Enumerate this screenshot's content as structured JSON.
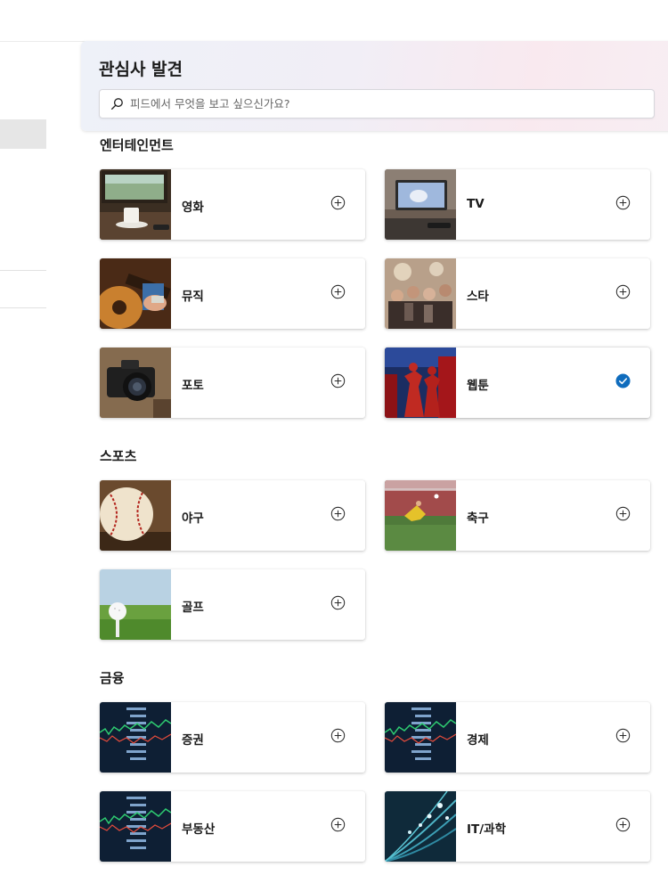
{
  "discover": {
    "title": "관심사 발견",
    "search_placeholder": "피드에서 무엇을 보고 싶으신가요?"
  },
  "sections": [
    {
      "title": "엔터테인먼트",
      "cards": [
        {
          "label": "영화",
          "thumb": "movie-thumb",
          "selected": false
        },
        {
          "label": "TV",
          "thumb": "tv-thumb",
          "selected": false
        },
        {
          "label": "뮤직",
          "thumb": "guitar-thumb",
          "selected": false
        },
        {
          "label": "스타",
          "thumb": "crowd-thumb",
          "selected": false
        },
        {
          "label": "포토",
          "thumb": "camera-thumb",
          "selected": false
        },
        {
          "label": "웹툰",
          "thumb": "comic-thumb",
          "selected": true
        }
      ]
    },
    {
      "title": "스포츠",
      "cards": [
        {
          "label": "야구",
          "thumb": "baseball-thumb",
          "selected": false
        },
        {
          "label": "축구",
          "thumb": "soccer-thumb",
          "selected": false
        },
        {
          "label": "골프",
          "thumb": "golf-thumb",
          "selected": false
        }
      ]
    },
    {
      "title": "금융",
      "cards": [
        {
          "label": "증권",
          "thumb": "stock-thumb",
          "selected": false
        },
        {
          "label": "경제",
          "thumb": "stock-thumb",
          "selected": false
        },
        {
          "label": "부동산",
          "thumb": "stock-thumb",
          "selected": false
        },
        {
          "label": "IT/과학",
          "thumb": "fiber-thumb",
          "selected": false
        }
      ]
    }
  ],
  "icons": {
    "add": "plus-circle-icon",
    "selected": "check-circle-icon",
    "search": "search-icon"
  },
  "colors": {
    "accent": "#0f6cbd"
  }
}
